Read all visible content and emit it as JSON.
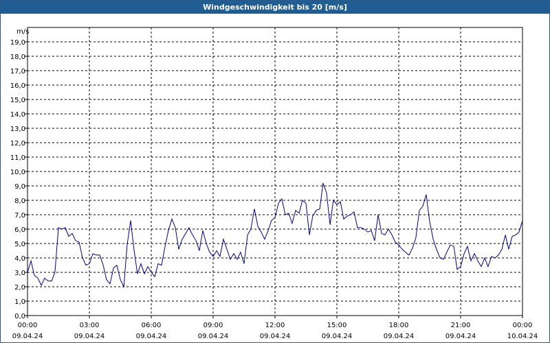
{
  "chart_data": {
    "type": "line",
    "title": "Windgeschwindigkeit bis 20 [m/s]",
    "ylabel": "m/s",
    "xlabel": "",
    "ylim": [
      0,
      20
    ],
    "y_tick_labels": [
      "0,0",
      "1,0",
      "2,0",
      "3,0",
      "4,0",
      "5,0",
      "6,0",
      "7,0",
      "8,0",
      "9,0",
      "10,0",
      "11,0",
      "12,0",
      "13,0",
      "14,0",
      "15,0",
      "16,0",
      "17,0",
      "18,0",
      "19,0"
    ],
    "x_tick_labels": [
      {
        "time": "00:00",
        "date": "09.04.24"
      },
      {
        "time": "03:00",
        "date": "09.04.24"
      },
      {
        "time": "06:00",
        "date": "09.04.24"
      },
      {
        "time": "09:00",
        "date": "09.04.24"
      },
      {
        "time": "12:00",
        "date": "09.04.24"
      },
      {
        "time": "15:00",
        "date": "09.04.24"
      },
      {
        "time": "18:00",
        "date": "09.04.24"
      },
      {
        "time": "21:00",
        "date": "09.04.24"
      },
      {
        "time": "00:00",
        "date": "10.04.24"
      }
    ],
    "grid": true,
    "line_color": "#00008b",
    "series": [
      {
        "x_hours": [
          0,
          0.17,
          0.33,
          0.5,
          0.67,
          0.83,
          1.0,
          1.17,
          1.33,
          1.5,
          1.67,
          1.83,
          2.0,
          2.17,
          2.33,
          2.5,
          2.67,
          2.83,
          3.0,
          3.17,
          3.33,
          3.5,
          3.67,
          3.83,
          4.0,
          4.17,
          4.33,
          4.5,
          4.67,
          4.83,
          5.0,
          5.17,
          5.33,
          5.5,
          5.67,
          5.83,
          6.0,
          6.17,
          6.33,
          6.5,
          6.67,
          6.83,
          7.0,
          7.17,
          7.33,
          7.5,
          7.67,
          7.83,
          8.0,
          8.17,
          8.33,
          8.5,
          8.67,
          8.83,
          9.0,
          9.17,
          9.33,
          9.5,
          9.67,
          9.83,
          10.0,
          10.17,
          10.33,
          10.5,
          10.67,
          10.83,
          11.0,
          11.17,
          11.33,
          11.5,
          11.67,
          11.83,
          12.0,
          12.17,
          12.33,
          12.5,
          12.67,
          12.83,
          13.0,
          13.17,
          13.33,
          13.5,
          13.67,
          13.83,
          14.0,
          14.17,
          14.33,
          14.5,
          14.67,
          14.83,
          15.0,
          15.17,
          15.33,
          15.5,
          15.67,
          15.83,
          16.0,
          16.17,
          16.33,
          16.5,
          16.67,
          16.83,
          17.0,
          17.17,
          17.33,
          17.5,
          17.67,
          17.83,
          18.0,
          18.17,
          18.33,
          18.5,
          18.67,
          18.83,
          19.0,
          19.17,
          19.33,
          19.5,
          19.67,
          19.83,
          20.0,
          20.17,
          20.33,
          20.5,
          20.67,
          20.83,
          21.0,
          21.17,
          21.33,
          21.5,
          21.67,
          21.83,
          22.0,
          22.17,
          22.33,
          22.5,
          22.67,
          22.83,
          23.0,
          23.17,
          23.33,
          23.5,
          23.67,
          23.83,
          24.0
        ],
        "values": [
          3.0,
          3.8,
          2.8,
          2.6,
          2.1,
          2.6,
          2.4,
          2.4,
          3.0,
          6.1,
          6.0,
          6.1,
          5.5,
          5.7,
          5.2,
          5.1,
          4.0,
          3.5,
          3.6,
          4.3,
          4.2,
          4.2,
          3.5,
          2.5,
          2.2,
          3.3,
          3.5,
          2.5,
          2.0,
          4.9,
          6.6,
          4.5,
          2.9,
          3.6,
          2.9,
          3.4,
          3.0,
          2.7,
          3.6,
          3.5,
          4.8,
          5.9,
          6.7,
          6.1,
          4.6,
          5.3,
          5.7,
          6.1,
          5.6,
          5.2,
          4.5,
          5.9,
          5.0,
          4.4,
          4.1,
          4.5,
          4.1,
          5.3,
          4.6,
          3.9,
          4.3,
          3.9,
          4.4,
          3.6,
          5.6,
          6.0,
          7.4,
          6.2,
          5.8,
          5.3,
          5.9,
          6.6,
          6.8,
          7.8,
          8.1,
          7.0,
          7.1,
          6.4,
          7.3,
          7.1,
          8.0,
          7.8,
          5.6,
          6.9,
          7.3,
          7.4,
          9.2,
          8.5,
          6.3,
          8.0,
          7.7,
          7.9,
          6.7,
          6.9,
          7.0,
          7.2,
          6.1,
          6.1,
          6.0,
          5.8,
          5.9,
          5.2,
          7.0,
          5.7,
          5.6,
          6.0,
          5.6,
          5.1,
          4.9,
          4.6,
          4.4,
          4.2,
          4.7,
          5.4,
          7.3,
          7.6,
          8.4,
          6.5,
          5.3,
          4.6,
          4.0,
          3.9,
          4.4,
          4.9,
          4.8,
          3.2,
          3.4,
          4.3,
          4.8,
          3.8,
          4.3,
          3.8,
          3.4,
          4.0,
          3.4,
          4.1,
          4.0,
          4.2,
          4.6,
          5.6,
          4.6,
          5.5,
          5.6,
          5.8,
          6.6,
          5.5
        ]
      }
    ]
  }
}
